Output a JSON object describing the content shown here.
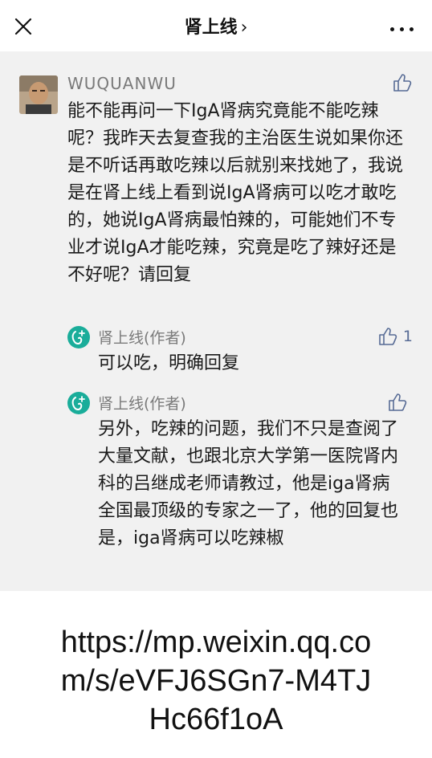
{
  "header": {
    "title": "肾上线",
    "chevron": "›"
  },
  "comment": {
    "username": "WUQUANWU",
    "text": "能不能再问一下IgA肾病究竟能不能吃辣呢？我昨天去复查我的主治医生说如果你还是不听话再敢吃辣以后就别来找她了，我说是在肾上线上看到说IgA肾病可以吃才敢吃的，她说IgA肾病最怕辣的，可能她们不专业才说IgA才能吃辣，究竟是吃了辣好还是不好呢？请回复"
  },
  "replies": [
    {
      "author": "肾上线(作者)",
      "like_count": "1",
      "text": "可以吃，明确回复"
    },
    {
      "author": "肾上线(作者)",
      "like_count": "",
      "text": "另外，吃辣的问题，我们不只是查阅了大量文献，也跟北京大学第一医院肾内科的吕继成老师请教过，他是iga肾病全国最顶级的专家之一了，他的回复也是，iga肾病可以吃辣椒"
    }
  ],
  "url_text": "https://mp.weixin.qq.com/s/eVFJ6SGn7-M4TJHc66f1oA",
  "colors": {
    "panel_bg": "#f1f1f1",
    "link_blue": "#576b95",
    "brand_green": "#1aad9a"
  },
  "icons": {
    "close": "close-icon",
    "more": "more-icon",
    "like": "thumbs-up-icon",
    "brand": "shenshangxian-logo-icon"
  }
}
